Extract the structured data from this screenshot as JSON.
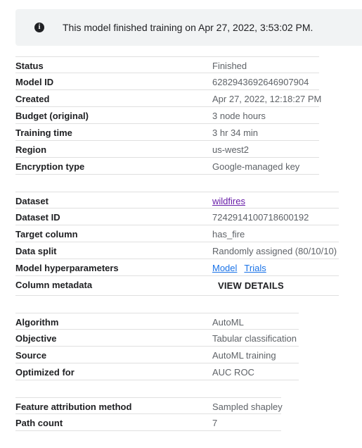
{
  "banner": {
    "icon": "info-icon",
    "message": "This model finished training on Apr 27, 2022, 3:53:02 PM."
  },
  "model_info": [
    {
      "label": "Status",
      "value": "Finished"
    },
    {
      "label": "Model ID",
      "value": "6282943692646907904"
    },
    {
      "label": "Created",
      "value": "Apr 27, 2022, 12:18:27 PM"
    },
    {
      "label": "Budget (original)",
      "value": "3 node hours"
    },
    {
      "label": "Training time",
      "value": "3 hr 34 min"
    },
    {
      "label": "Region",
      "value": "us-west2"
    },
    {
      "label": "Encryption type",
      "value": "Google-managed key"
    }
  ],
  "dataset_info": {
    "dataset": {
      "label": "Dataset",
      "value": "wildfires"
    },
    "dataset_id": {
      "label": "Dataset ID",
      "value": "7242914100718600192"
    },
    "target_column": {
      "label": "Target column",
      "value": "has_fire"
    },
    "data_split": {
      "label": "Data split",
      "value": "Randomly assigned (80/10/10)"
    },
    "hyperparameters": {
      "label": "Model hyperparameters",
      "model_link": "Model",
      "trials_link": "Trials"
    },
    "column_metadata": {
      "label": "Column metadata",
      "button": "VIEW DETAILS"
    }
  },
  "algorithm_info": [
    {
      "label": "Algorithm",
      "value": "AutoML"
    },
    {
      "label": "Objective",
      "value": "Tabular classification"
    },
    {
      "label": "Source",
      "value": "AutoML training"
    },
    {
      "label": "Optimized for",
      "value": "AUC ROC"
    }
  ],
  "attribution_info": [
    {
      "label": "Feature attribution method",
      "value": "Sampled shapley"
    },
    {
      "label": "Path count",
      "value": "7"
    }
  ]
}
